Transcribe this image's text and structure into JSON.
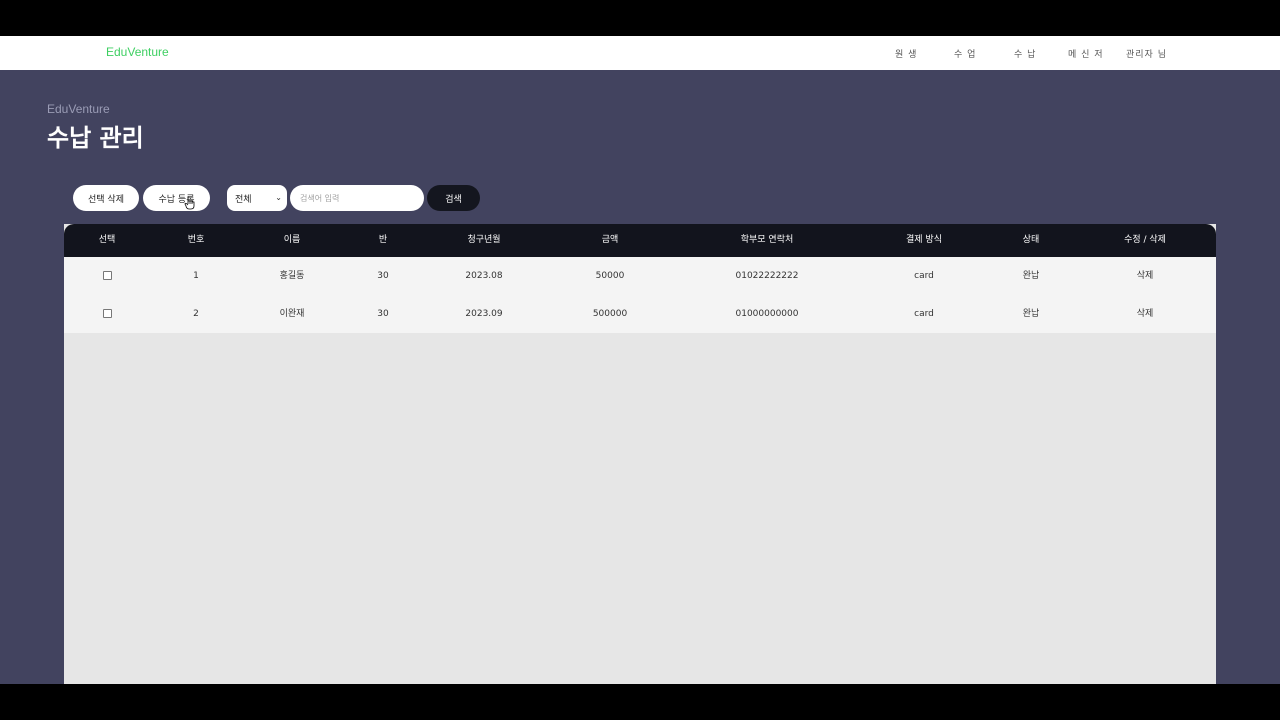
{
  "nav": {
    "brand": "EduVenture",
    "items": [
      "원 생",
      "수 업",
      "수 납",
      "메 신 저",
      "관리자 님"
    ]
  },
  "header": {
    "subtitle": "EduVenture",
    "title": "수납 관리"
  },
  "toolbar": {
    "delete_selected": "선택 삭제",
    "register": "수납 등록",
    "filter_value": "전체",
    "search_placeholder": "검색어 입력",
    "search_button": "검색"
  },
  "table": {
    "columns": [
      "선택",
      "번호",
      "이름",
      "반",
      "청구년월",
      "금액",
      "학부모 연락처",
      "결제 방식",
      "상태",
      "수정 / 삭제"
    ],
    "rows": [
      {
        "no": "1",
        "name": "홍길동",
        "class": "30",
        "billing_month": "2023.08",
        "amount": "50000",
        "parent_phone": "01022222222",
        "payment_method": "card",
        "status": "완납",
        "action": "삭제"
      },
      {
        "no": "2",
        "name": "이완재",
        "class": "30",
        "billing_month": "2023.09",
        "amount": "500000",
        "parent_phone": "01000000000",
        "payment_method": "card",
        "status": "완납",
        "action": "삭제"
      }
    ]
  },
  "colors": {
    "brand_green": "#3ecf62",
    "content_bg": "#42435f",
    "table_header": "#12141d"
  }
}
